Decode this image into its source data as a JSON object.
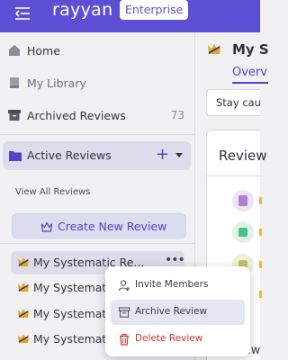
{
  "header": {
    "brand": "rayyan",
    "badge": "Enterprise",
    "bg_color": "#5d4fd4"
  },
  "sidebar": {
    "items": [
      {
        "label": "Home",
        "icon": "home-icon"
      },
      {
        "label": "My Library",
        "icon": "library-icon"
      },
      {
        "label": "Archived Reviews",
        "icon": "archive-box-icon",
        "count": "73"
      }
    ],
    "active_reviews": {
      "label": "Active Reviews",
      "icon": "folder-icon",
      "add": "+"
    },
    "view_all": "View All Reviews",
    "create_button": "Create New Review",
    "reviews": [
      {
        "label": "My Systematic Re...",
        "selected": true
      },
      {
        "label": "My Systematic"
      },
      {
        "label": "My Systematic"
      },
      {
        "label": "My Systematic"
      }
    ],
    "more_actions": "•••"
  },
  "main": {
    "title": "My S",
    "tab": "Overv",
    "banner": "Stay cau",
    "card_title": "Review",
    "bottom_text": "Review"
  },
  "context_menu": {
    "items": [
      {
        "label": "Invite Members",
        "icon": "user-plus-icon"
      },
      {
        "label": "Archive Review",
        "icon": "archive-icon"
      },
      {
        "label": "Delete Review",
        "icon": "trash-icon",
        "color": "#dc2f2f"
      }
    ]
  },
  "colors": {
    "accent": "#4e45c9",
    "crown": "#e0a820",
    "danger": "#dc2f2f"
  }
}
